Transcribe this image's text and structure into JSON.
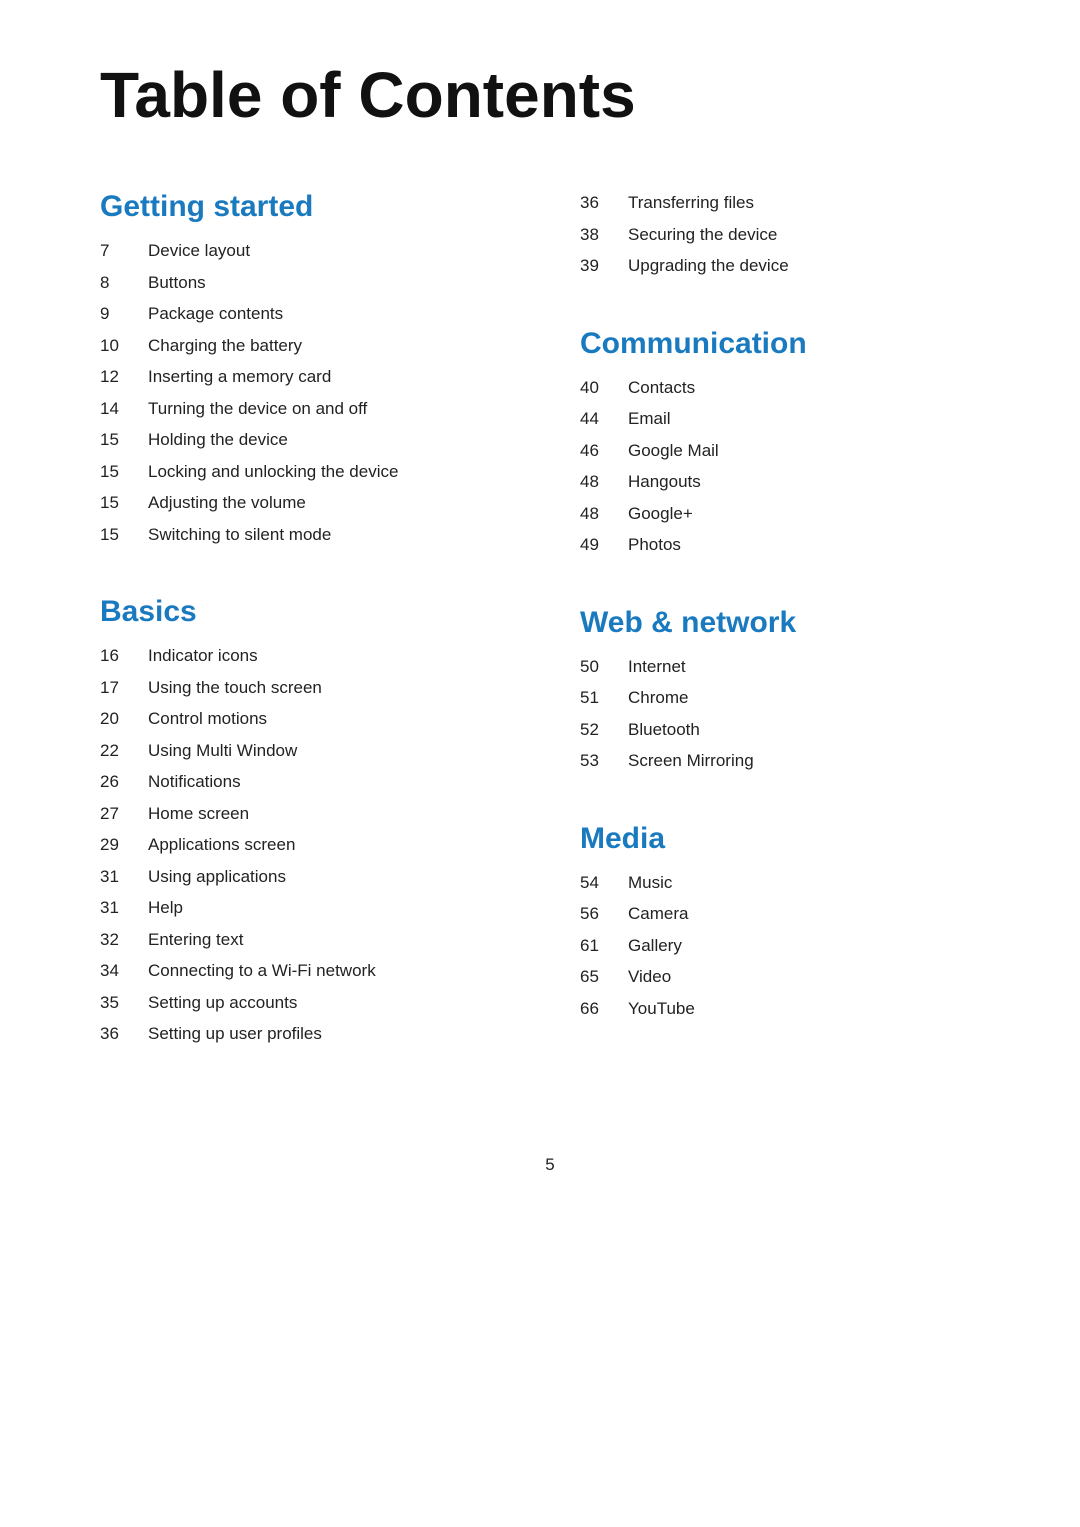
{
  "page": {
    "title": "Table of Contents",
    "footer_page_number": "5"
  },
  "sections": {
    "getting_started": {
      "title": "Getting started",
      "items": [
        {
          "num": "7",
          "label": "Device layout"
        },
        {
          "num": "8",
          "label": "Buttons"
        },
        {
          "num": "9",
          "label": "Package contents"
        },
        {
          "num": "10",
          "label": "Charging the battery"
        },
        {
          "num": "12",
          "label": "Inserting a memory card"
        },
        {
          "num": "14",
          "label": "Turning the device on and off"
        },
        {
          "num": "15",
          "label": "Holding the device"
        },
        {
          "num": "15",
          "label": "Locking and unlocking the device"
        },
        {
          "num": "15",
          "label": "Adjusting the volume"
        },
        {
          "num": "15",
          "label": "Switching to silent mode"
        }
      ]
    },
    "basics": {
      "title": "Basics",
      "items": [
        {
          "num": "16",
          "label": "Indicator icons"
        },
        {
          "num": "17",
          "label": "Using the touch screen"
        },
        {
          "num": "20",
          "label": "Control motions"
        },
        {
          "num": "22",
          "label": "Using Multi Window"
        },
        {
          "num": "26",
          "label": "Notifications"
        },
        {
          "num": "27",
          "label": "Home screen"
        },
        {
          "num": "29",
          "label": "Applications screen"
        },
        {
          "num": "31",
          "label": "Using applications"
        },
        {
          "num": "31",
          "label": "Help"
        },
        {
          "num": "32",
          "label": "Entering text"
        },
        {
          "num": "34",
          "label": "Connecting to a Wi-Fi network"
        },
        {
          "num": "35",
          "label": "Setting up accounts"
        },
        {
          "num": "36",
          "label": "Setting up user profiles"
        }
      ]
    },
    "right_top": {
      "items_no_header": [
        {
          "num": "36",
          "label": "Transferring files"
        },
        {
          "num": "38",
          "label": "Securing the device"
        },
        {
          "num": "39",
          "label": "Upgrading the device"
        }
      ]
    },
    "communication": {
      "title": "Communication",
      "items": [
        {
          "num": "40",
          "label": "Contacts"
        },
        {
          "num": "44",
          "label": "Email"
        },
        {
          "num": "46",
          "label": "Google Mail"
        },
        {
          "num": "48",
          "label": "Hangouts"
        },
        {
          "num": "48",
          "label": "Google+"
        },
        {
          "num": "49",
          "label": "Photos"
        }
      ]
    },
    "web_network": {
      "title": "Web & network",
      "items": [
        {
          "num": "50",
          "label": "Internet"
        },
        {
          "num": "51",
          "label": "Chrome"
        },
        {
          "num": "52",
          "label": "Bluetooth"
        },
        {
          "num": "53",
          "label": "Screen Mirroring"
        }
      ]
    },
    "media": {
      "title": "Media",
      "items": [
        {
          "num": "54",
          "label": "Music"
        },
        {
          "num": "56",
          "label": "Camera"
        },
        {
          "num": "61",
          "label": "Gallery"
        },
        {
          "num": "65",
          "label": "Video"
        },
        {
          "num": "66",
          "label": "YouTube"
        }
      ]
    }
  }
}
